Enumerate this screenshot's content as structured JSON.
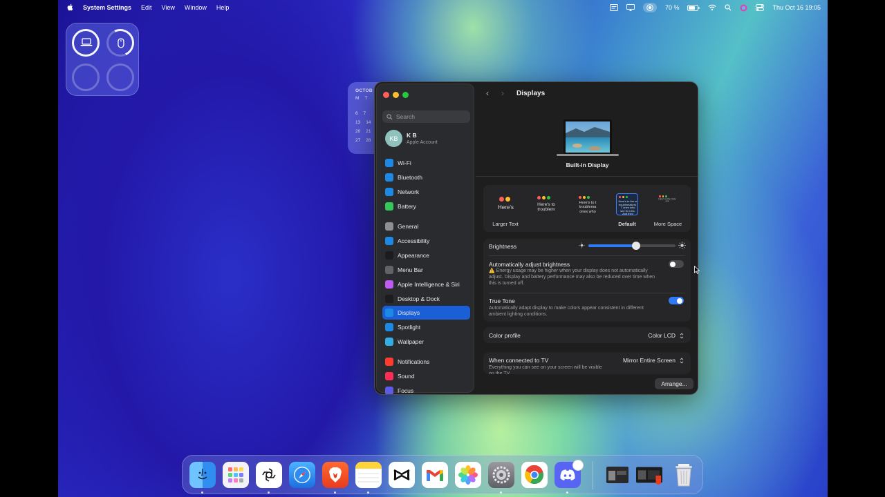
{
  "menubar": {
    "app_name": "System Settings",
    "menus": [
      "Edit",
      "View",
      "Window",
      "Help"
    ],
    "battery_percent": "70 %",
    "datetime": "Thu Oct 16  19:05"
  },
  "calendar_widget": {
    "month": "OCTOB",
    "weekday_headers": [
      "M",
      "T"
    ],
    "rows": [
      [
        "6",
        "7"
      ],
      [
        "13",
        "14"
      ],
      [
        "20",
        "21"
      ],
      [
        "27",
        "28"
      ]
    ]
  },
  "sidebar": {
    "search_placeholder": "Search",
    "account": {
      "initials": "KB",
      "name": "K B",
      "subtitle": "Apple Account"
    },
    "items": [
      {
        "label": "Wi-Fi",
        "icon": "wifi-icon",
        "color": "#1e88e5"
      },
      {
        "label": "Bluetooth",
        "icon": "bluetooth-icon",
        "color": "#1e88e5"
      },
      {
        "label": "Network",
        "icon": "globe-icon",
        "color": "#1e88e5"
      },
      {
        "label": "Battery",
        "icon": "battery-icon",
        "color": "#34c759"
      },
      {
        "label": "General",
        "icon": "gear-icon",
        "color": "#8e8e93"
      },
      {
        "label": "Accessibility",
        "icon": "accessibility-icon",
        "color": "#1e88e5"
      },
      {
        "label": "Appearance",
        "icon": "appearance-icon",
        "color": "#1c1c1e"
      },
      {
        "label": "Menu Bar",
        "icon": "menubar-icon",
        "color": "#636366"
      },
      {
        "label": "Apple Intelligence & Siri",
        "icon": "siri-icon",
        "color": "#bf5af2"
      },
      {
        "label": "Desktop & Dock",
        "icon": "dock-icon",
        "color": "#1c1c1e"
      },
      {
        "label": "Displays",
        "icon": "sun-icon",
        "color": "#1e88e5"
      },
      {
        "label": "Spotlight",
        "icon": "spotlight-icon",
        "color": "#1e88e5"
      },
      {
        "label": "Wallpaper",
        "icon": "wallpaper-icon",
        "color": "#32ade6"
      },
      {
        "label": "Notifications",
        "icon": "bell-icon",
        "color": "#ff3b30"
      },
      {
        "label": "Sound",
        "icon": "speaker-icon",
        "color": "#ff2d55"
      },
      {
        "label": "Focus",
        "icon": "moon-icon",
        "color": "#5e5ce6"
      }
    ],
    "selected": "Displays"
  },
  "content": {
    "title": "Displays",
    "display_name": "Built-in Display",
    "resolutions": [
      {
        "label": "Larger Text",
        "sample": "Here's"
      },
      {
        "label": "",
        "sample": "Here's to troublem"
      },
      {
        "label": "",
        "sample": "Here's to t troublema ones who"
      },
      {
        "label": "Default",
        "sample": "Here's to the cr troublemakers. T ones who see th rules. And they"
      },
      {
        "label": "More Space",
        "sample": "Here's to the crazy one"
      }
    ],
    "selected_resolution": "Default",
    "brightness": {
      "label": "Brightness",
      "value": 0.55
    },
    "auto_brightness": {
      "label": "Automatically adjust brightness",
      "warning": "⚠️ Energy usage may be higher when your display does not automatically adjust. Display and battery performance may also be reduced over time when this is turned off.",
      "on": false
    },
    "true_tone": {
      "label": "True Tone",
      "description": "Automatically adapt display to make colors appear consistent in different ambient lighting conditions.",
      "on": true
    },
    "color_profile": {
      "label": "Color profile",
      "value": "Color LCD"
    },
    "tv": {
      "label": "When connected to TV",
      "value": "Mirror Entire Screen",
      "description": "Everything you can see on your screen will be visible on the TV."
    },
    "arrange_button": "Arrange..."
  },
  "dock": {
    "apps": [
      "Finder",
      "Launchpad",
      "ChatGPT",
      "Safari",
      "Brave",
      "Notes",
      "CapCut",
      "Gmail",
      "Photos",
      "System Settings",
      "Chrome",
      "Discord"
    ],
    "running": [
      "ChatGPT",
      "Brave",
      "Notes",
      "System Settings",
      "Discord",
      "Finder"
    ]
  }
}
